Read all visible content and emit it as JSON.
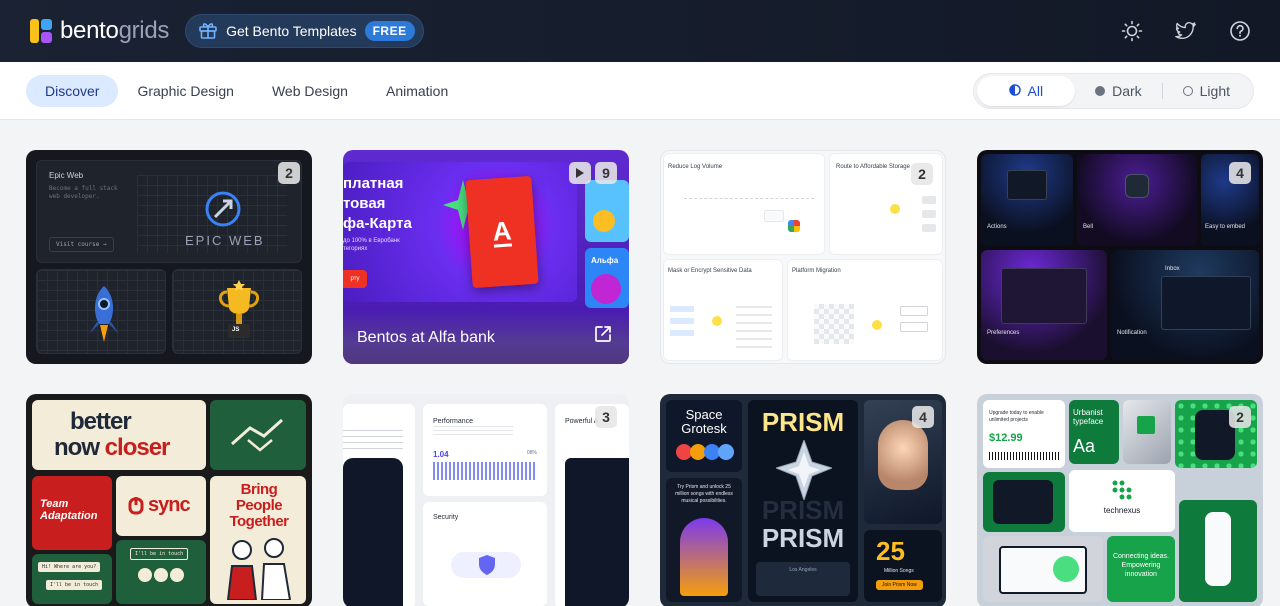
{
  "header": {
    "logo_main": "bento",
    "logo_accent": "grids",
    "promo_label": "Get Bento Templates",
    "promo_badge": "FREE",
    "icons": [
      "sun-icon",
      "twitter-icon",
      "help-icon"
    ]
  },
  "filters": {
    "categories": [
      "Discover",
      "Graphic Design",
      "Web Design",
      "Animation"
    ],
    "active_category": "Discover",
    "themes": [
      "All",
      "Dark",
      "Light"
    ],
    "active_theme": "All"
  },
  "cards": [
    {
      "count": "2",
      "epic_small": "Epic Web",
      "epic_desc": "Become a full stack web developer.",
      "epic_btn": "Visit course →",
      "epic_big": "EPIC WEB",
      "trophy_tag": "JS"
    },
    {
      "count": "9",
      "caption": "Bentos at Alfa bank",
      "ru_lines": [
        "платная",
        "товая",
        "фа-Карта"
      ],
      "ru_small": "до 100% в Евробанк",
      "ru_small2": "тегориях",
      "logo_letter": "A",
      "side_text": "Альфа",
      "btn": "рту"
    },
    {
      "count": "2",
      "t1": "Reduce Log Volume",
      "t2": "Route to Affordable Storage",
      "t3": "Mask or Encrypt Sensitive Data",
      "t4": "Platform Migration"
    },
    {
      "count": "4",
      "labels": [
        "Actions",
        "Bell",
        "Easy to embed",
        "Preferences",
        "Notification",
        "Inbox"
      ]
    },
    {
      "better": "better",
      "now": "now",
      "closer": "closer",
      "team": "Team Adaptation",
      "sync": "sync",
      "bring": "Bring People Together",
      "in_touch": "I'll be in touch",
      "where": "Hi! Where are you?",
      "in_touch2": "I'll be in touch"
    },
    {
      "count": "3",
      "perf": "Performance",
      "value": "1.04",
      "pct": "08%",
      "security": "Security",
      "powerful": "Powerful A"
    },
    {
      "count": "4",
      "space": "Space",
      "grotesk": "Grotesk",
      "prism": "PRISM",
      "prism_line": "Try Prism and unlock 25 million songs with endless musical possibilities.",
      "big_num": "25",
      "songs": "Million Songs",
      "free": "Join Prism Now",
      "player": "Los Angeles"
    },
    {
      "count": "2",
      "urbanist": "Urbanist typeface",
      "aa": "Aa",
      "upgrade": "Upgrade today to enable unlimited projects",
      "price": "$12.99",
      "technexus": "technexus",
      "connecting": "Connecting ideas. Empowering innovation"
    }
  ],
  "colors": {
    "accent": "#1d4ed8",
    "active_pill": "#dbeafe",
    "header_bg": "#151c2c",
    "alfa_red": "#ef3124",
    "tech_green": "#16a34a"
  }
}
